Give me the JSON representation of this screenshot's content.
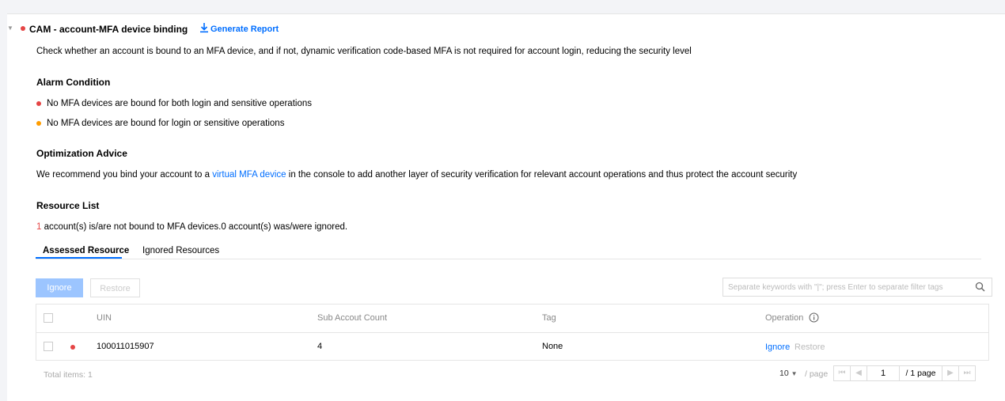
{
  "check": {
    "title": "CAM - account-MFA device binding",
    "generate_report": "Generate Report",
    "description": "Check whether an account is bound to an MFA device, and if not, dynamic verification code-based MFA is not required for account login, reducing the security level"
  },
  "alarm": {
    "heading": "Alarm Condition",
    "items": [
      {
        "text": "No MFA devices are bound for both login and sensitive operations",
        "color": "#e54545"
      },
      {
        "text": "No MFA devices are bound for login or sensitive operations",
        "color": "#ff9d00"
      }
    ]
  },
  "advice": {
    "heading": "Optimization Advice",
    "prefix": "We recommend you bind your account to a ",
    "link": "virtual MFA device",
    "suffix": " in the console to add another layer of security verification for relevant account operations and thus protect the account security"
  },
  "resources": {
    "heading": "Resource List",
    "count": "1",
    "summary": " account(s) is/are not bound to MFA devices.0  account(s) was/were ignored."
  },
  "tabs": {
    "assessed": "Assessed Resource",
    "ignored": "Ignored Resources"
  },
  "toolbar": {
    "ignore": "Ignore",
    "restore": "Restore",
    "search_placeholder": "Separate keywords with \"|\"; press Enter to separate filter tags"
  },
  "table": {
    "headers": {
      "uin": "UIN",
      "sub_count": "Sub Accout Count",
      "tag": "Tag",
      "operation": "Operation"
    },
    "rows": [
      {
        "uin": "100011015907",
        "sub_count": "4",
        "tag": "None",
        "op_ignore": "Ignore",
        "op_restore": "Restore",
        "risk_color": "#e54545"
      }
    ]
  },
  "footer": {
    "total": "Total items: 1",
    "page_size": "10",
    "per_page": "/ page",
    "page": "1",
    "page_total": "/ 1 page"
  },
  "colors": {
    "accent": "#006eff",
    "danger": "#e54545",
    "warning": "#ff9d00"
  }
}
